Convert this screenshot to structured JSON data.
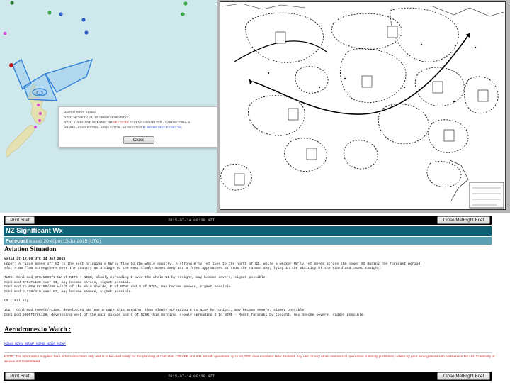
{
  "map": {
    "popup": {
      "line1": "WSPS21 NZKL 140000",
      "line2": "NZZO SIGMET 2 VALID 140000/140400 NZKL-",
      "line3_a": "NZZO AUCKLAND OCEANIC FIR ",
      "line3_b": "SEV TURB",
      "line3_c": " FCST WI S3150 E17545 - S2800 W17000 - S",
      "line4_a": "W16945 - S3315 W17815 - S3545 E17730 - S3150 E17545 ",
      "line4_b": "FL280/380 MOV E 15KT NC",
      "close_label": "Close"
    },
    "colors": {
      "sea": "#cfe8ec",
      "land": "#e9e4b4",
      "sigmet": "#2f7fd8"
    }
  },
  "brief": {
    "top_bar": {
      "print_label": "Print Brief",
      "timestamp": "2015-07-14 00:39 NZT",
      "close_label": "Close MetFlight Brief"
    },
    "title": "NZ Significant Wx",
    "forecast_label": "Forecast",
    "forecast_issued": " issued 20:40pm 13-Jul-2015 (UTC)",
    "aviation_heading": "Aviation Situation",
    "situation": {
      "valid": "Valid at 12.00 UTC 14 Jul 2015",
      "upper": "Upper: A ridge moves off NZ to the east bringing a NW'ly flow to the whole country. A strong W'ly jet lies to the north of NZ, while a weaker NW'ly jet moves across the lower SI during the forecast period.",
      "sfc": "Sfc: A NW flow strengthens over the country as a ridge to the east slowly moves away and a front approaches SI from the Tasman Sea, lying in the vicinity of the Fiordland coast tonight."
    },
    "turb_lines": [
      "TURB: Ocnl mod SFC/8000ft NW of KITO - NZWU, slowly spreading E over the whole NI by tonight, may become severe, sigmet possible.",
      "Ocnl mod SFC/FL120 over SI, may become severe, sigmet possible.",
      "Ocnl mod in MEW FL180/280 w/s/E of the main divide, E of NZWF and S of NZCH, may become severe, sigmet possible.",
      "Ocnl mod FL230/410 over NZ, may become severe, sigmet possible."
    ],
    "cb_line": "CB : Nil sig.",
    "ice_lines": [
      "ICE : Ocnl mod 7000ft/FL180, developing abt North Cape this morning, then slowly spreading E to NZAA by tonight, may become severe, sigmet possible.",
      "Ocnl mod 6000ft/FL120, developing west of the main divide and S of NZHK this morning, slowly spreading S to NZMB - Mount Taranaki by tonight, may become severe, sigmet possible."
    ],
    "aerodromes_heading": "Aerodromes to Watch :",
    "aerodromes": "NZNS NZNV NZWF NZMB NZRO NZWP",
    "note": "NOTE: The information supplied here is for subscribers only and is to be used solely for the planning of CAR Part 135 VFR and IFR aircraft operations up to 10,000ft over mainland New Zealand. Any use for any other commercial operations is strictly prohibited, unless by prior arrangement with MetService NZ Ltd. Continuity of service not Guaranteed.",
    "bottom_bar": {
      "print_label": "Print Brief",
      "timestamp": "2015-07-14 00:39 NZT",
      "close_label": "Close MetFlight Brief"
    },
    "colors": {
      "title_bg": "#0e5f73",
      "forecast_bg": "#5d9fb4",
      "note": "#d11a1a"
    }
  }
}
